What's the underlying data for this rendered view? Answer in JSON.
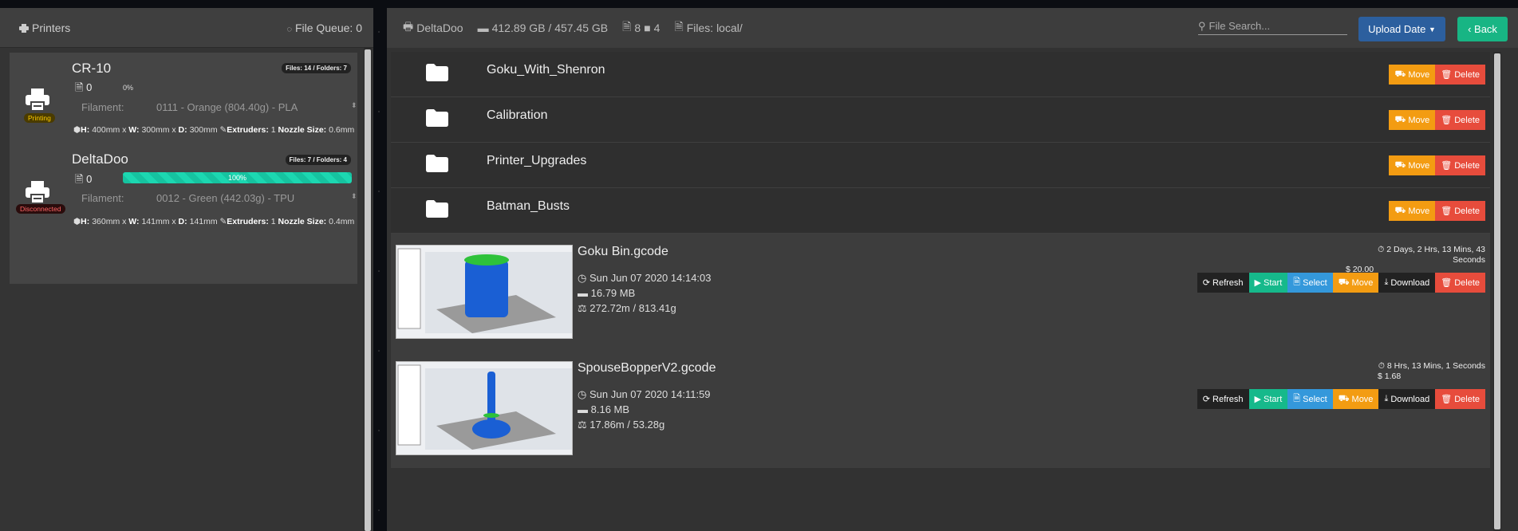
{
  "left": {
    "title": "Printers",
    "queue": "File Queue: 0"
  },
  "printers": [
    {
      "name": "CR-10",
      "files": "Files: 14 / Folders: 7",
      "count": "0",
      "progress": "0%",
      "progress_value": 0,
      "status": "Printing",
      "status_color": "#4a3b00",
      "filament_label": "Filament:",
      "filament": "0111 - Orange (804.40g) - PLA",
      "dims": {
        "h_label": "H:",
        "h": "400mm x",
        "w_label": "W:",
        "w": "300mm x",
        "d_label": "D:",
        "d": "300mm",
        "ext_label": "Extruders:",
        "ext": "1",
        "noz_label": "Nozzle Size:",
        "noz": "0.6mm"
      }
    },
    {
      "name": "DeltaDoo",
      "files": "Files: 7 / Folders: 4",
      "count": "0",
      "progress": "100%",
      "progress_value": 100,
      "status": "Disconnected",
      "status_color": "#4a0e0e",
      "filament_label": "Filament:",
      "filament": "0012 - Green (442.03g) - TPU",
      "dims": {
        "h_label": "H:",
        "h": "360mm x",
        "w_label": "W:",
        "w": "141mm x",
        "d_label": "D:",
        "d": "141mm",
        "ext_label": "Extruders:",
        "ext": "1",
        "noz_label": "Nozzle Size:",
        "noz": "0.4mm"
      }
    }
  ],
  "header": {
    "printer": "DeltaDoo",
    "storage": "412.89 GB / 457.45 GB",
    "files": "8",
    "folders": "4",
    "path": "Files: local/",
    "search_placeholder": "File Search...",
    "sort": "Upload Date",
    "back": "Back"
  },
  "folders": [
    {
      "name": "Goku_With_Shenron"
    },
    {
      "name": "Calibration"
    },
    {
      "name": "Printer_Upgrades"
    },
    {
      "name": "Batman_Busts"
    }
  ],
  "buttons": {
    "move": "Move",
    "delete": "Delete",
    "refresh": "Refresh",
    "start": "Start",
    "select": "Select",
    "download": "Download"
  },
  "files": [
    {
      "name": "Goku Bin.gcode",
      "date": "Sun Jun 07 2020 14:14:03",
      "size": "16.79 MB",
      "usage": "272.72m / 813.41g",
      "time": "2 Days, 2 Hrs, 13 Mins, 43 Seconds",
      "cost": "20.00"
    },
    {
      "name": "SpouseBopperV2.gcode",
      "date": "Sun Jun 07 2020 14:11:59",
      "size": "8.16 MB",
      "usage": "17.86m / 53.28g",
      "time": "8 Hrs, 13 Mins, 1 Seconds",
      "cost": "1.68"
    }
  ],
  "colors": {
    "accent_green": "#16b98b",
    "move": "#f39c12",
    "delete": "#e74c3c",
    "select": "#3498db",
    "upload": "#2c5f9e"
  }
}
